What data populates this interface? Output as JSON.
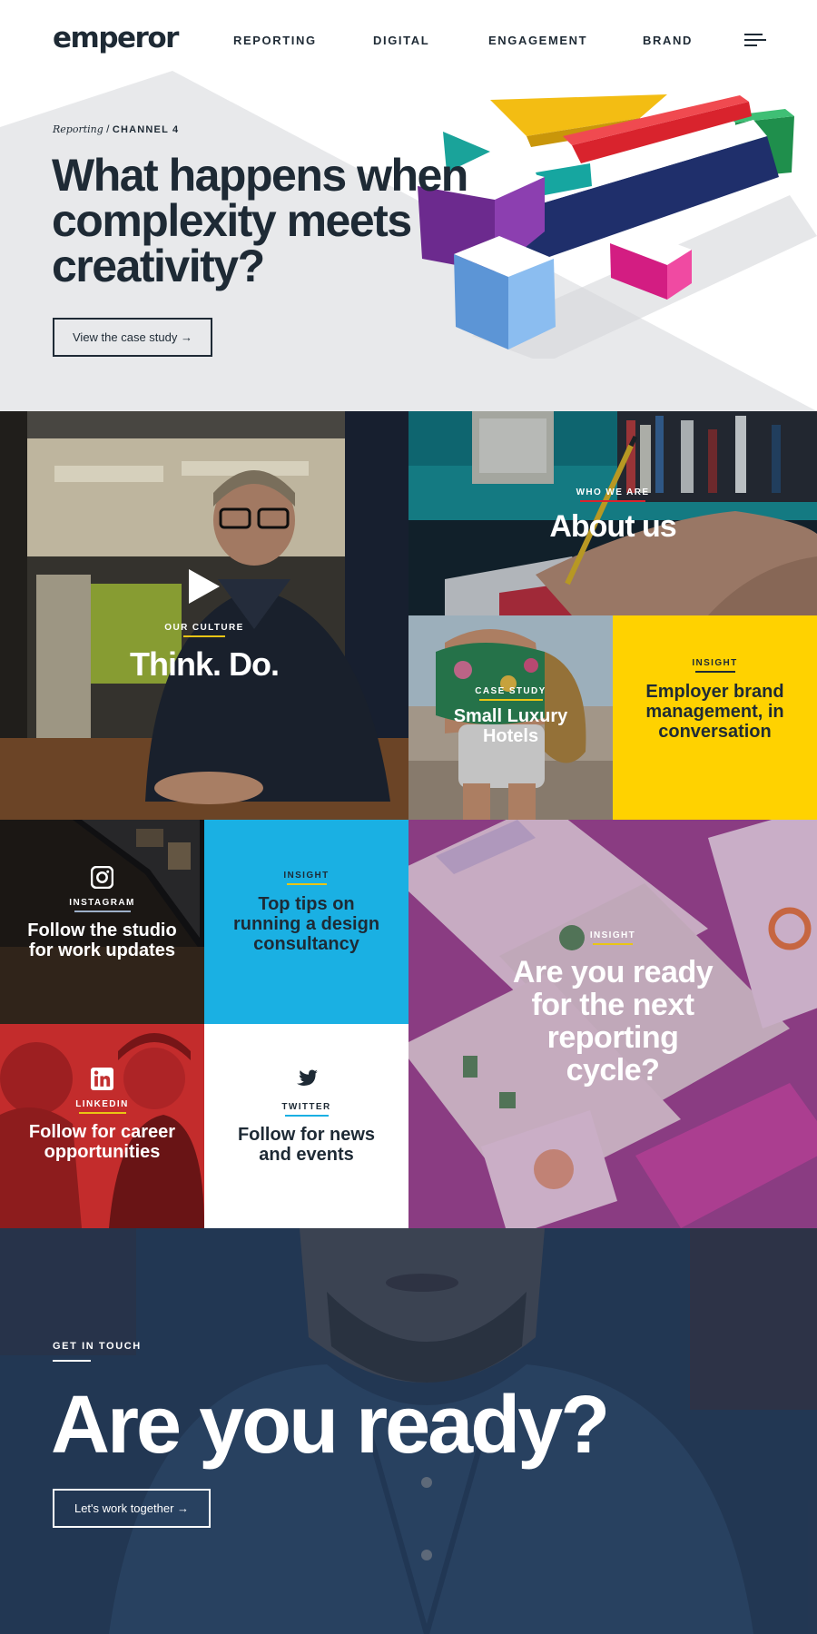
{
  "header": {
    "logo": "emperor",
    "nav": [
      "REPORTING",
      "DIGITAL",
      "ENGAGEMENT",
      "BRAND"
    ],
    "menu_icon": "hamburger-menu-icon"
  },
  "hero": {
    "breadcrumb_link": "Reporting",
    "breadcrumb_separator": "/",
    "breadcrumb_current": "CHANNEL 4",
    "title": "What happens when complexity meets creativity?",
    "button": "View the case study →"
  },
  "tiles": {
    "culture": {
      "label": "OUR CULTURE",
      "title": "Think. Do.",
      "icon": "play-icon"
    },
    "about": {
      "label": "WHO WE ARE",
      "title": "About us"
    },
    "luxury": {
      "label": "CASE STUDY",
      "title": "Small Luxury Hotels"
    },
    "employer": {
      "label": "INSIGHT",
      "title": "Employer brand management, in conversation"
    },
    "instagram": {
      "label": "INSTAGRAM",
      "title": "Follow the studio for work updates",
      "icon": "instagram-icon"
    },
    "tips": {
      "label": "INSIGHT",
      "title": "Top tips on running a design consultancy"
    },
    "reporting": {
      "label": "INSIGHT",
      "title": "Are you ready for the next reporting cycle?"
    },
    "linkedin": {
      "label": "LINKEDIN",
      "title": "Follow for career opportunities",
      "icon": "linkedin-icon"
    },
    "twitter": {
      "label": "TWITTER",
      "title": "Follow for news and events",
      "icon": "twitter-icon"
    }
  },
  "cta": {
    "label": "GET IN TOUCH",
    "title": "Are you ready?",
    "button": "Let's work together →"
  },
  "colors": {
    "navy": "#1e2a35",
    "yellow": "#ffd200",
    "cyan": "#1ab0e3",
    "red": "#cf2e2e",
    "purple": "#8c3b86"
  }
}
